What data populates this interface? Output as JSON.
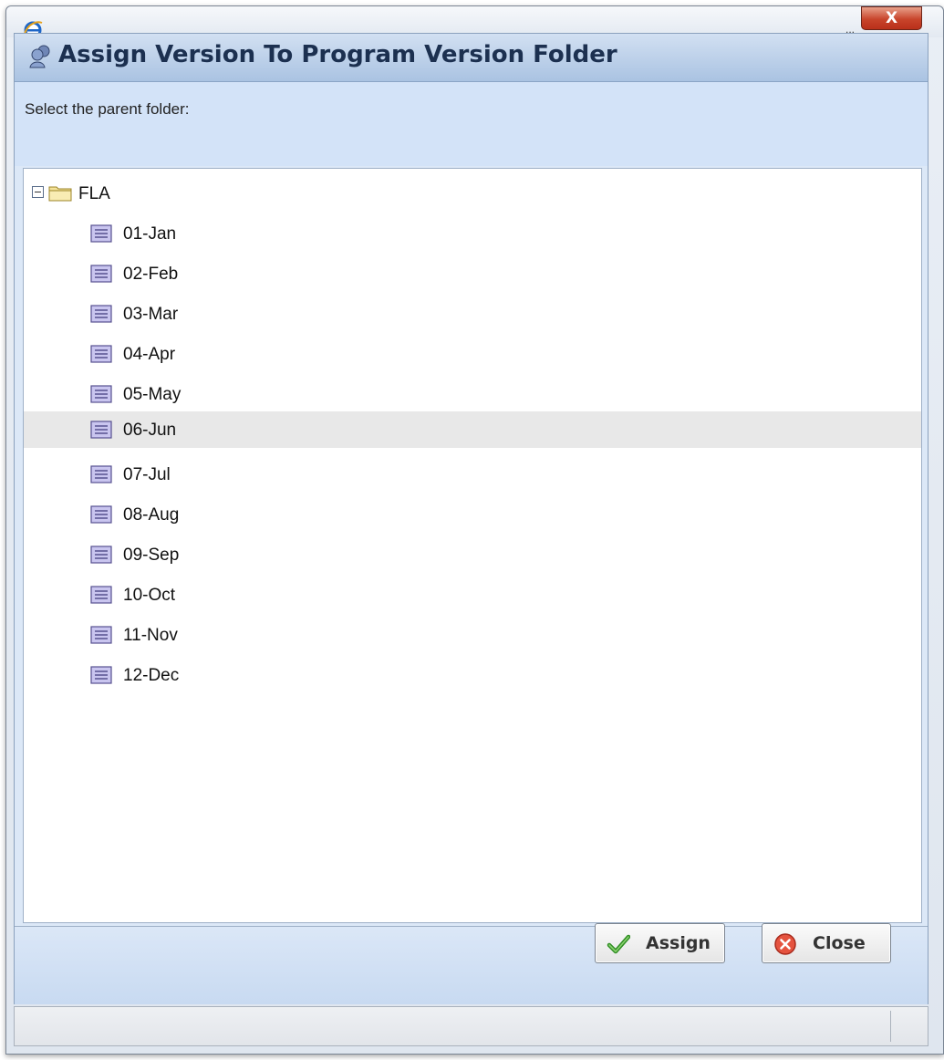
{
  "window": {
    "title_ellipsis": "...",
    "close_glyph": "X"
  },
  "dialog": {
    "title": "Assign Version To Program Version Folder",
    "prompt": "Select the parent folder:"
  },
  "tree": {
    "root": {
      "label": "FLA",
      "expanded": true
    },
    "children": [
      {
        "label": "01-Jan",
        "selected": false
      },
      {
        "label": "02-Feb",
        "selected": false
      },
      {
        "label": "03-Mar",
        "selected": false
      },
      {
        "label": "04-Apr",
        "selected": false
      },
      {
        "label": "05-May",
        "selected": false
      },
      {
        "label": "06-Jun",
        "selected": true
      },
      {
        "label": "07-Jul",
        "selected": false
      },
      {
        "label": "08-Aug",
        "selected": false
      },
      {
        "label": "09-Sep",
        "selected": false
      },
      {
        "label": "10-Oct",
        "selected": false
      },
      {
        "label": "11-Nov",
        "selected": false
      },
      {
        "label": "12-Dec",
        "selected": false
      }
    ]
  },
  "buttons": {
    "assign_label": "Assign",
    "close_label": "Close"
  },
  "icons": {
    "browser": "ie-icon",
    "header": "users-icon",
    "root_folder": "folder-icon",
    "child_folder": "document-folder-icon",
    "assign": "checkmark-icon",
    "close": "cancel-icon"
  },
  "colors": {
    "header_bg": "#aac3e2",
    "dialog_bg": "#dce8f7",
    "selected_row": "#e8e8e8",
    "close_x": "#c8442b",
    "title_text": "#1c3050"
  }
}
